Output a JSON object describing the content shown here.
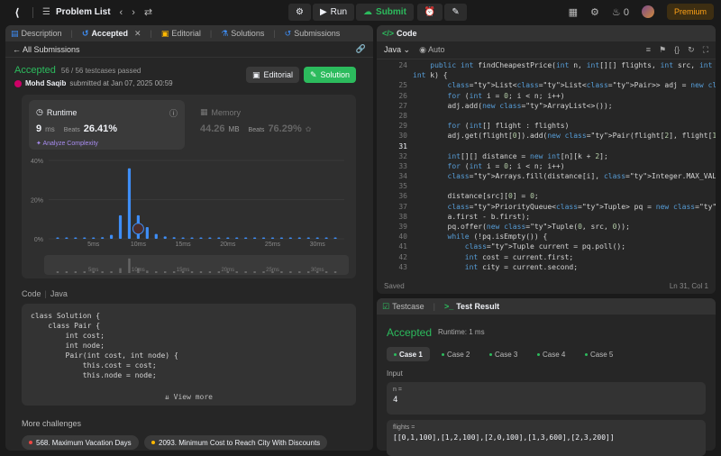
{
  "topbar": {
    "title": "Problem List",
    "run_label": "Run",
    "submit_label": "Submit",
    "streak_count": "0",
    "premium_label": "Premium"
  },
  "left_tabs": [
    {
      "label": "Description"
    },
    {
      "label": "Accepted"
    },
    {
      "label": "Editorial"
    },
    {
      "label": "Solutions"
    },
    {
      "label": "Submissions"
    }
  ],
  "submission": {
    "back_label": "All Submissions",
    "status": "Accepted",
    "testcases": "56 / 56 testcases passed",
    "user": "Mohd Saqib",
    "submitted_text": "submitted at Jan 07, 2025 00:59",
    "editorial_btn": "Editorial",
    "solution_btn": "Solution"
  },
  "runtime": {
    "title": "Runtime",
    "value": "9",
    "unit": "ms",
    "beats_label": "Beats",
    "beats_pct": "26.41%",
    "analyze": "Analyze Complexity"
  },
  "memory": {
    "title": "Memory",
    "value": "44.26",
    "unit": "MB",
    "beats_label": "Beats",
    "beats_pct": "76.29%"
  },
  "chart_data": {
    "type": "bar",
    "y_ticks": [
      "40%",
      "20%",
      "0%"
    ],
    "ylim": [
      0,
      40
    ],
    "x_tick_labels": [
      "5ms",
      "10ms",
      "15ms",
      "20ms",
      "25ms",
      "30ms"
    ],
    "x_tick_values": [
      5,
      10,
      15,
      20,
      25,
      30
    ],
    "xlim": [
      0,
      33
    ],
    "x": [
      1,
      2,
      3,
      4,
      5,
      6,
      7,
      8,
      9,
      10,
      11,
      12,
      13,
      14,
      15,
      16,
      17,
      18,
      19,
      20,
      21,
      22,
      23,
      24,
      25,
      26,
      27,
      28,
      29,
      30,
      31,
      32
    ],
    "values": [
      0.5,
      0.5,
      0.5,
      0.5,
      0.5,
      0.8,
      2,
      12,
      36,
      12,
      6,
      2.5,
      1.2,
      0.8,
      0.6,
      0.6,
      0.5,
      0.5,
      0.5,
      0.5,
      0.5,
      0.5,
      0.5,
      0.5,
      0.5,
      0.5,
      0.5,
      0.5,
      0.5,
      0.5,
      0.5,
      0.5
    ],
    "user_marker_x": 10,
    "grid": true
  },
  "left_code": {
    "label": "Code",
    "lang": "Java",
    "lines": [
      "class Solution {",
      "    class Pair {",
      "        int cost;",
      "        int node;",
      "",
      "        Pair(int cost, int node) {",
      "            this.cost = cost;",
      "            this.node = node;"
    ],
    "view_more": "View more"
  },
  "more_challenges": {
    "title": "More challenges",
    "items": [
      {
        "label": "568. Maximum Vacation Days",
        "color": "#ef4743"
      },
      {
        "label": "2093. Minimum Cost to Reach City With Discounts",
        "color": "#ffb800"
      }
    ]
  },
  "editor": {
    "title": "Code",
    "language": "Java",
    "auto_label": "Auto",
    "status_left": "Saved",
    "status_right": "Ln 31, Col 1",
    "lines": [
      {
        "n": "24",
        "t": "    public int findCheapestPrice(int n, int[][] flights, int src, int dst,"
      },
      {
        "n": "",
        "t": "int k) {"
      },
      {
        "n": "25",
        "t": "        List<List<Pair>> adj = new ArrayList<>();"
      },
      {
        "n": "26",
        "t": "        for (int i = 0; i < n; i++)"
      },
      {
        "n": "27",
        "t": "        adj.add(new ArrayList<>());"
      },
      {
        "n": "28",
        "t": ""
      },
      {
        "n": "29",
        "t": "        for (int[] flight : flights)"
      },
      {
        "n": "30",
        "t": "        adj.get(flight[0]).add(new Pair(flight[2], flight[1]));"
      },
      {
        "n": "31",
        "t": ""
      },
      {
        "n": "32",
        "t": "        int[][] distance = new int[n][k + 2];"
      },
      {
        "n": "33",
        "t": "        for (int i = 0; i < n; i++)"
      },
      {
        "n": "34",
        "t": "        Arrays.fill(distance[i], Integer.MAX_VALUE);"
      },
      {
        "n": "35",
        "t": ""
      },
      {
        "n": "36",
        "t": "        distance[src][0] = 0;"
      },
      {
        "n": "37",
        "t": "        PriorityQueue<Tuple> pq = new PriorityQueue<>((a, b) ->"
      },
      {
        "n": "38",
        "t": "        a.first - b.first);"
      },
      {
        "n": "39",
        "t": "        pq.offer(new Tuple(0, src, 0));"
      },
      {
        "n": "40",
        "t": "        while (!pq.isEmpty()) {"
      },
      {
        "n": "41",
        "t": "            Tuple current = pq.poll();"
      },
      {
        "n": "42",
        "t": "            int cost = current.first;"
      },
      {
        "n": "43",
        "t": "            int city = current.second;"
      }
    ]
  },
  "testpanel": {
    "tab_testcase": "Testcase",
    "tab_result": "Test Result",
    "status": "Accepted",
    "runtime": "Runtime: 1 ms",
    "cases": [
      "Case 1",
      "Case 2",
      "Case 3",
      "Case 4",
      "Case 5"
    ],
    "input_label": "Input",
    "inputs": [
      {
        "key": "n =",
        "value": "4"
      },
      {
        "key": "flights =",
        "value": "[[0,1,100],[1,2,100],[2,0,100],[1,3,600],[2,3,200]]"
      }
    ]
  }
}
